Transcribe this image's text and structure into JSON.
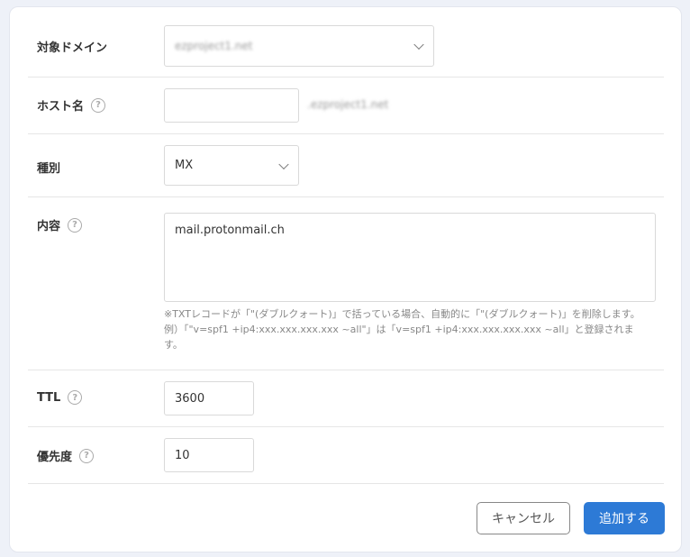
{
  "form": {
    "domain": {
      "label": "対象ドメイン",
      "value": "ezproject1.net"
    },
    "host": {
      "label": "ホスト名",
      "value": "",
      "suffix": ".ezproject1.net"
    },
    "type": {
      "label": "種別",
      "value": "MX"
    },
    "content": {
      "label": "内容",
      "value": "mail.protonmail.ch",
      "note1": "※TXTレコードが「\"(ダブルクォート)」で括っている場合、自動的に「\"(ダブルクォート)」を削除します。",
      "note2": "例）「\"v=spf1 +ip4:xxx.xxx.xxx.xxx ~all\"」は「v=spf1 +ip4:xxx.xxx.xxx.xxx ~all」と登録されます。"
    },
    "ttl": {
      "label": "TTL",
      "value": "3600"
    },
    "priority": {
      "label": "優先度",
      "value": "10"
    }
  },
  "help_glyph": "?",
  "buttons": {
    "cancel": "キャンセル",
    "submit": "追加する"
  },
  "colors": {
    "primary": "#2d7ad6",
    "background": "#eef1f8"
  }
}
